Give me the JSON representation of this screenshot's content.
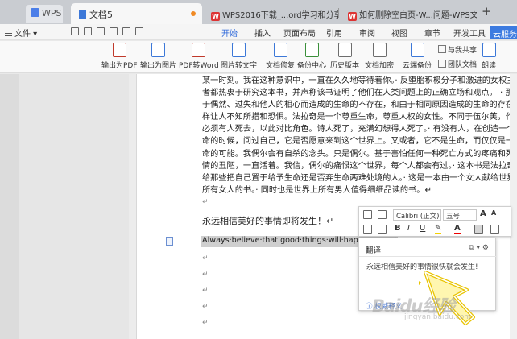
{
  "tabs": {
    "wps_home": "WPS",
    "document": "文档5",
    "web1": "WPS2016下载_...ord学习和分享平台",
    "web2": "如何删除空白页-W...问题-WPS文字-",
    "new_tab": "+"
  },
  "menubar": {
    "file": "文件",
    "tabs": [
      "开始",
      "插入",
      "页面布局",
      "引用",
      "审阅",
      "视图",
      "章节",
      "开发工具"
    ],
    "cloud": "云服务"
  },
  "ribbon": {
    "buttons": [
      "输出为PDF",
      "输出为图片",
      "PDF转Word",
      "图片转文字",
      "文档修复",
      "备份中心",
      "历史版本",
      "文档加密",
      "云端备份",
      "朗读"
    ],
    "share": "与我共享",
    "team": "团队文档"
  },
  "document": {
    "paragraph_lines": [
      "某一时刻。我在这种意识中，一直在久久地等待着你。· 反堕胎积极分子和激进的女权主义",
      "者都热衷于研究这本书，并声称该书证明了他们在人类问题上的正确立场和观点。 · 那种由",
      "于偶然、过失和他人的相心而造成的生命的不存在，和由于相同原因造成的生命的存在，同",
      "样让人不知所措和恐惧。法拉奇是一个尊重生命，尊重人权的女性。不同于伍尔芙，作品中",
      "必须有人死去，以此对比角色。诗人死了，充满幻想得人死了。· 有没有人，在创造一个生",
      "命的时候，问过自己，它是否愿意来到这个世界上。又或者，它不是生命，而仅仅是一个生",
      "命的可能。我偶尔会有自杀的念头。只是偶尔。基于害怕任何一种死亡方式的疼痛和死亡表",
      "情的丑陋，一直活着。我信，偶尔的痛恨这个世界，每个人都会有过。· 这本书是法拉奇献",
      "给那些把自己置于给予生命还是否弃生命两难处境的人。· 这是一本由一个女人献给世界上",
      "所有女人的书。· 同时也是世界上所有男人值得细细品读的书。↵"
    ],
    "empty_mark": "↵",
    "chinese_sentence": "永远相信美好的事情即将发生！↵",
    "english_sentence": "Always·believe·that·good·things·will·happen·soon!"
  },
  "format_toolbar": {
    "font": "Calibri (正文)",
    "size": "五号",
    "bold": "B",
    "italic": "I",
    "underline": "U",
    "font_color": "A"
  },
  "translate": {
    "title": "翻译",
    "result": "永远相信美好的事情很快就会发生!",
    "footer": "权威释义"
  },
  "watermark": {
    "brand": "Baidu经验",
    "url": "jingyan.baidu.com"
  }
}
